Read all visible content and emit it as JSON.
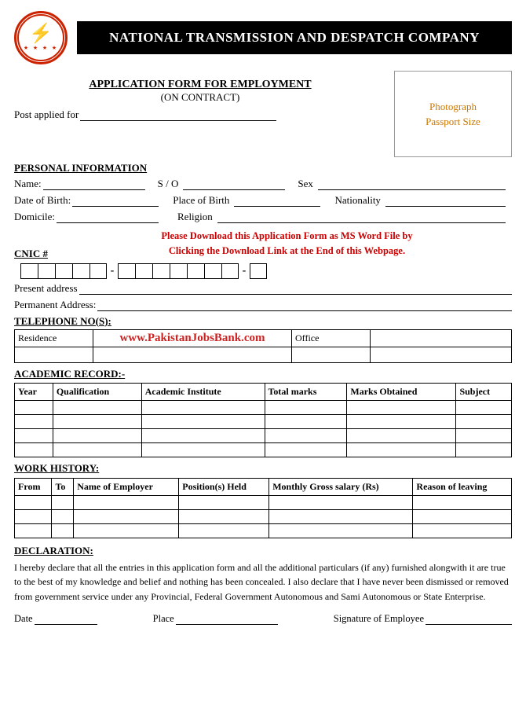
{
  "header": {
    "company_name": "NATIONAL TRANSMISSION AND DESPATCH COMPANY",
    "logo_icon": "⚡",
    "logo_stars": "★ ★ ★ ★"
  },
  "form": {
    "title": "APPLICATION FORM FOR EMPLOYMENT",
    "subtitle": "(ON CONTRACT)",
    "post_applied_label": "Post applied for",
    "photo_text": "Photograph\nPassport Size"
  },
  "personal_info": {
    "section_title": "PERSONAL INFORMATION",
    "name_label": "Name:",
    "so_label": "S / O",
    "sex_label": "Sex",
    "dob_label": "Date of Birth:",
    "pob_label": "Place of Birth",
    "nationality_label": "Nationality",
    "domicile_label": "Domicile:",
    "religion_label": "Religion",
    "cnic_label": "CNIC #",
    "cnic_notice": "Please Download this Application Form as MS Word File by\nClicking the Download Link at the End of this Webpage.",
    "present_address_label": "Present address",
    "permanent_address_label": "Permanent Address:"
  },
  "telephone": {
    "title": "TELEPHONE NO(S):",
    "col1": "Residence",
    "col2": "Office",
    "watermark": "www.PakistanJobsBank.com"
  },
  "academic": {
    "title": "ACADEMIC RECORD:-",
    "columns": [
      "Year",
      "Qualification",
      "Academic Institute",
      "Total marks",
      "Marks Obtained",
      "Subject"
    ],
    "empty_rows": 4
  },
  "work_history": {
    "title": "WORK HISTORY:",
    "columns": [
      "From",
      "To",
      "Name of Employer",
      "Position(s) Held",
      "Monthly Gross salary (Rs)",
      "Reason of leaving"
    ],
    "empty_rows": 3
  },
  "declaration": {
    "title": "DECLARATION:",
    "text": "I hereby declare that all the entries in this application form and all the additional particulars (if any) furnished alongwith it are true to the best of my knowledge and belief and nothing has been concealed. I also declare that I have never been dismissed or removed from government service under any Provincial, Federal Government Autonomous and Sami Autonomous or State Enterprise.",
    "date_label": "Date",
    "place_label": "Place",
    "signature_label": "Signature of Employee"
  }
}
